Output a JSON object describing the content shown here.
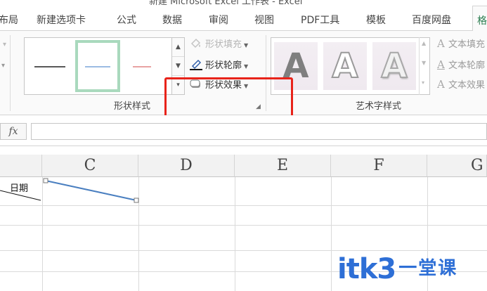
{
  "window": {
    "title": "新建 Microsoft Excel 工作表 - Excel"
  },
  "tabs": [
    {
      "label": "布局"
    },
    {
      "label": "新建选项卡"
    },
    {
      "label": "公式"
    },
    {
      "label": "数据"
    },
    {
      "label": "审阅"
    },
    {
      "label": "视图"
    },
    {
      "label": "PDF工具"
    },
    {
      "label": "模板"
    },
    {
      "label": "百度网盘"
    },
    {
      "label": "格式"
    }
  ],
  "ribbon": {
    "shape_styles": {
      "group_label": "形状样式",
      "fill_label": "形状填充",
      "outline_label": "形状轮廓",
      "effects_label": "形状效果",
      "line_colors": [
        "#595959",
        "#9bbbe3",
        "#e8a3a3"
      ]
    },
    "wordart_styles": {
      "group_label": "艺术字样式",
      "sample_letter": "A",
      "text_fill_label": "文本填充",
      "text_outline_label": "文本轮廓",
      "text_effects_label": "文本效果"
    }
  },
  "formula_bar": {
    "fx_label": "fx",
    "value": ""
  },
  "sheet": {
    "columns": [
      "C",
      "D",
      "E",
      "F",
      "G"
    ],
    "cell_text": "日期"
  },
  "watermark": {
    "brand": "itk3",
    "tagline": "一堂课"
  },
  "colors": {
    "highlight": "#e8231a",
    "selected_style_border": "#a9d9bd",
    "drawn_line": "#4a7fc0"
  }
}
